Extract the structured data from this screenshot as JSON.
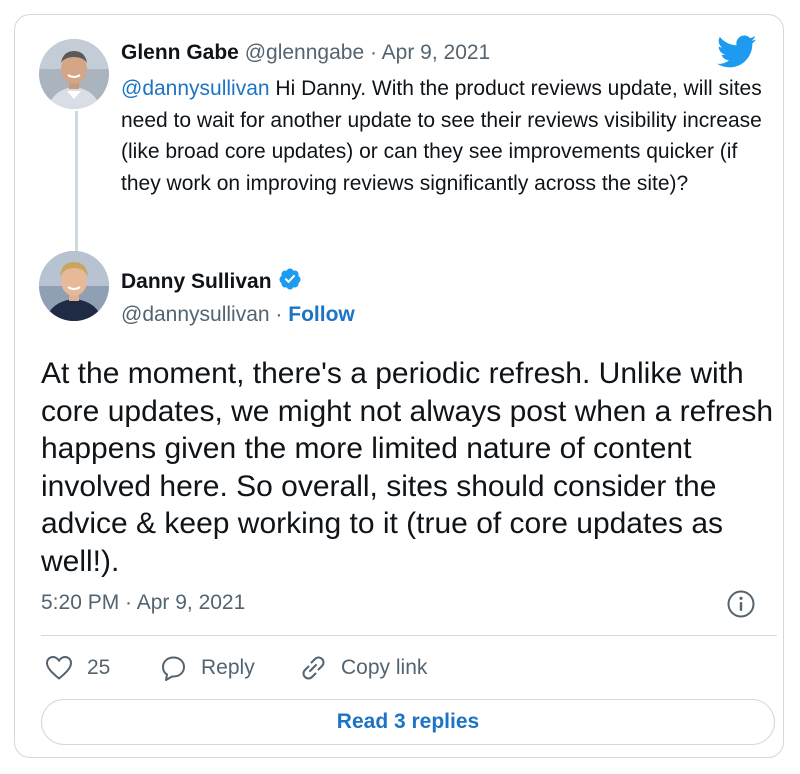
{
  "parent_tweet": {
    "author_name": "Glenn Gabe",
    "author_handle": "@glenngabe",
    "separator": "·",
    "date": "Apr 9, 2021",
    "mention": "@dannysullivan",
    "text": " Hi Danny. With the product reviews update, will sites need to wait for another update to see their reviews visibility increase (like broad core updates) or can they see improvements quicker (if they work on improving reviews significantly across the site)?"
  },
  "main_tweet": {
    "author_name": "Danny Sullivan",
    "author_handle": "@dannysullivan",
    "separator": "·",
    "follow_label": "Follow",
    "text": "At the moment, there's a periodic refresh. Unlike with core updates, we might not always post when a refresh happens given the more limited nature of content involved here. So overall, sites should consider the advice & keep working to it (true of core updates as well!).",
    "timestamp": "5:20 PM · Apr 9, 2021"
  },
  "actions": {
    "like_count": "25",
    "reply_label": "Reply",
    "copy_link_label": "Copy link"
  },
  "read_replies_label": "Read 3 replies",
  "icons": {
    "brand": "twitter-bird-icon",
    "verified": "verified-badge-icon",
    "info": "info-icon",
    "like": "heart-icon",
    "reply": "speech-bubble-icon",
    "copy_link": "link-icon"
  },
  "colors": {
    "link": "#1d74c5",
    "twitter_blue": "#1d9bf0",
    "muted_text": "#536471",
    "border": "#cfd9de"
  }
}
